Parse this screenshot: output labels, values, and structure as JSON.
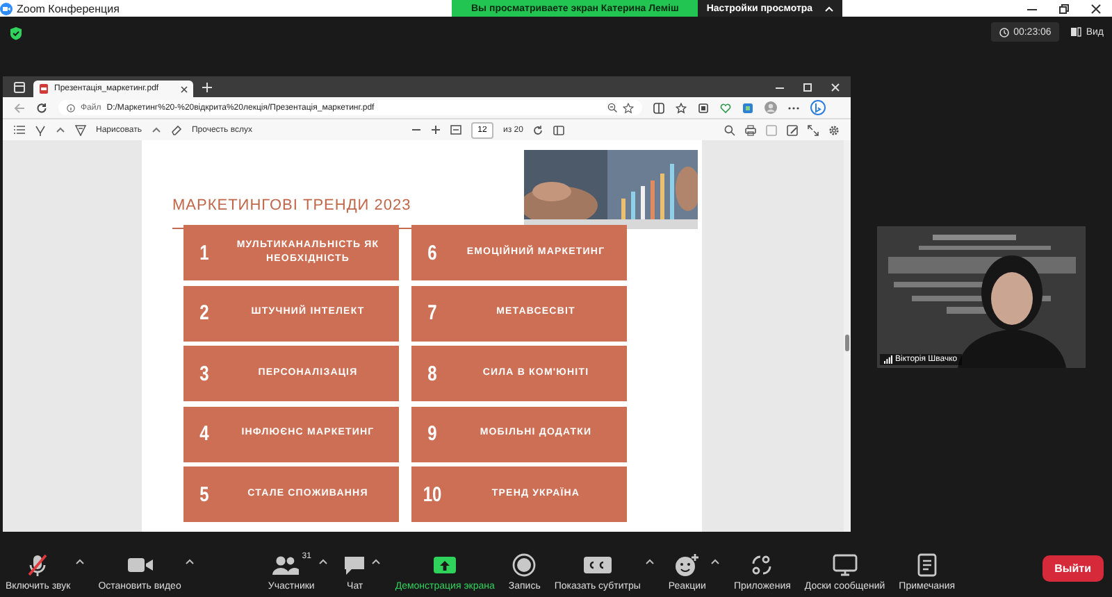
{
  "window": {
    "title": "Zoom Конференция"
  },
  "share_banner": {
    "text": "Вы просматриваете экран Катерина Леміш",
    "options_button": "Настройки просмотра"
  },
  "meeting": {
    "timer": "00:23:06",
    "view_button": "Вид"
  },
  "browser": {
    "tab_title": "Презентація_маркетинг.pdf",
    "address_label": "Файл",
    "address": "D:/Маркетинг%20-%20відкрита%20лекція/Презентація_маркетинг.pdf"
  },
  "pdf_toolbar": {
    "draw_label": "Нарисовать",
    "read_aloud": "Прочесть вслух",
    "page": "12",
    "page_total": "из 20"
  },
  "slide": {
    "title": "МАРКЕТИНГОВІ ТРЕНДИ 2023",
    "trends": [
      {
        "number": "1",
        "label": "МУЛЬТИКАНАЛЬНІСТЬ ЯК НЕОБХІДНІСТЬ"
      },
      {
        "number": "2",
        "label": "ШТУЧНИЙ ІНТЕЛЕКТ"
      },
      {
        "number": "3",
        "label": "ПЕРСОНАЛІЗАЦІЯ"
      },
      {
        "number": "4",
        "label": "ІНФЛЮЄНС МАРКЕТИНГ"
      },
      {
        "number": "5",
        "label": "СТАЛЕ СПОЖИВАННЯ"
      },
      {
        "number": "6",
        "label": "ЕМОЦІЙНИЙ МАРКЕТИНГ"
      },
      {
        "number": "7",
        "label": "МЕТАВСЕСВІТ"
      },
      {
        "number": "8",
        "label": "СИЛА В КОМ'ЮНІТІ"
      },
      {
        "number": "9",
        "label": "МОБІЛЬНІ ДОДАТКИ"
      },
      {
        "number": "10",
        "label": "ТРЕНД УКРАЇНА"
      }
    ]
  },
  "video": {
    "name": "Вікторія Швачко"
  },
  "toolbar": {
    "items": [
      {
        "kind": "mic-muted",
        "label": "Включить звук",
        "caret": true,
        "highlighted": false
      },
      {
        "kind": "camera",
        "label": "Остановить видео",
        "caret": true,
        "highlighted": false
      },
      {
        "kind": "participants",
        "label": "Участники",
        "count": "31",
        "caret": true,
        "highlighted": false
      },
      {
        "kind": "chat",
        "label": "Чат",
        "caret": true,
        "highlighted": false
      },
      {
        "kind": "share",
        "label": "Демонстрация экрана",
        "caret": false,
        "highlighted": true
      },
      {
        "kind": "record",
        "label": "Запись",
        "caret": false,
        "highlighted": false
      },
      {
        "kind": "captions",
        "label": "Показать субтитры",
        "caret": true,
        "highlighted": false
      },
      {
        "kind": "reactions",
        "label": "Реакции",
        "caret": true,
        "highlighted": false
      },
      {
        "kind": "apps",
        "label": "Приложения",
        "caret": false,
        "highlighted": false
      },
      {
        "kind": "whiteboard",
        "label": "Доски сообщений",
        "caret": false,
        "highlighted": false
      },
      {
        "kind": "notes",
        "label": "Примечания",
        "caret": false,
        "highlighted": false
      }
    ],
    "leave": "Выйти"
  }
}
